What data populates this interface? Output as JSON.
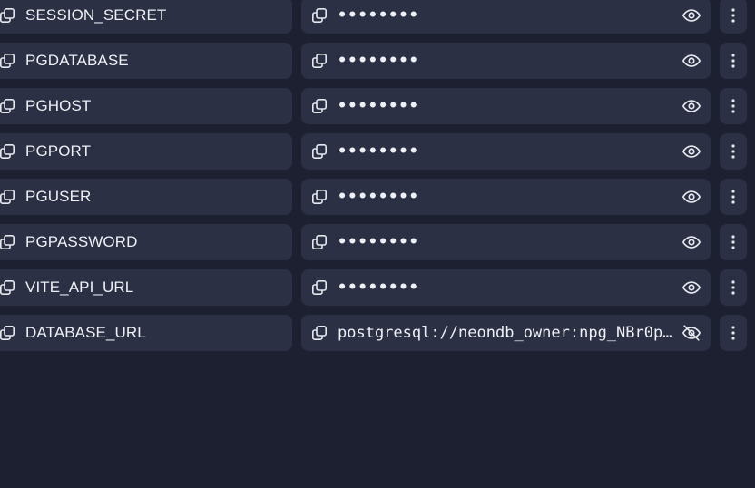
{
  "secrets": [
    {
      "key": "SESSION_SECRET",
      "value": "••••••••",
      "revealed": false
    },
    {
      "key": "PGDATABASE",
      "value": "••••••••",
      "revealed": false
    },
    {
      "key": "PGHOST",
      "value": "••••••••",
      "revealed": false
    },
    {
      "key": "PGPORT",
      "value": "••••••••",
      "revealed": false
    },
    {
      "key": "PGUSER",
      "value": "••••••••",
      "revealed": false
    },
    {
      "key": "PGPASSWORD",
      "value": "••••••••",
      "revealed": false
    },
    {
      "key": "VITE_API_URL",
      "value": "••••••••",
      "revealed": false
    },
    {
      "key": "DATABASE_URL",
      "value": "postgresql://neondb_owner:npg_NBr0p…",
      "revealed": true
    }
  ],
  "icons": {
    "copy": "copy-icon",
    "show": "eye-icon",
    "hide": "eye-off-icon",
    "more": "more-vertical-icon"
  },
  "colors": {
    "background": "#1c2030",
    "field": "#2b3044",
    "text": "#eef0f5"
  }
}
